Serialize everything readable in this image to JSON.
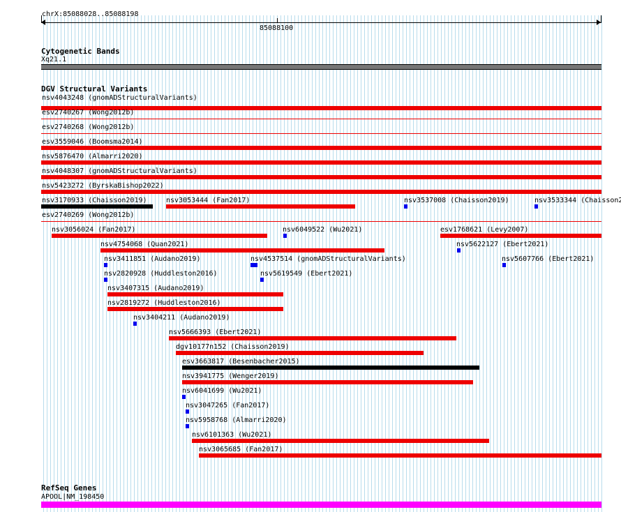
{
  "ruler": {
    "position_label": "chrX:85088028..85088198",
    "tick_label": "85088100"
  },
  "cytoband": {
    "title": "Cytogenetic Bands",
    "band": "Xq21.1",
    "band_color": "#777777"
  },
  "dgv": {
    "title": "DGV Structural Variants",
    "colors": {
      "loss": "#ee0000",
      "gain": "#0000ee",
      "other": "#000000"
    },
    "features": [
      {
        "label": "nsv4043248 (gnomADStructuralVariants)",
        "color": "loss"
      },
      {
        "label": "esv2740267 (Wong2012b)",
        "color": "loss"
      },
      {
        "label": "esv2740268 (Wong2012b)",
        "color": "loss"
      },
      {
        "label": "esv3559046 (Boomsma2014)",
        "color": "loss"
      },
      {
        "label": "nsv5876470 (Almarri2020)",
        "color": "loss"
      },
      {
        "label": "nsv4048307 (gnomADStructuralVariants)",
        "color": "loss"
      },
      {
        "label": "nsv5423272 (ByrskaBishop2022)",
        "color": "loss"
      },
      {
        "label": "nsv3170933 (Chaisson2019)",
        "color": "other"
      },
      {
        "label": "nsv3053444 (Fan2017)",
        "color": "loss"
      },
      {
        "label": "nsv3537008 (Chaisson2019)",
        "color": "gain"
      },
      {
        "label": "nsv3533344 (Chaisson2",
        "color": "gain"
      },
      {
        "label": "esv2740269 (Wong2012b)",
        "color": "loss"
      },
      {
        "label": "nsv3056024 (Fan2017)",
        "color": "loss"
      },
      {
        "label": "nsv6049522 (Wu2021)",
        "color": "gain"
      },
      {
        "label": "esv1768621 (Levy2007)",
        "color": "loss"
      },
      {
        "label": "nsv4754068 (Quan2021)",
        "color": "loss"
      },
      {
        "label": "nsv5622127 (Ebert2021)",
        "color": "gain"
      },
      {
        "label": "nsv3411851 (Audano2019)",
        "color": "gain"
      },
      {
        "label": "nsv4537514 (gnomADStructuralVariants)",
        "color": "gain"
      },
      {
        "label": "nsv5607766 (Ebert2021)",
        "color": "gain"
      },
      {
        "label": "nsv2820928 (Huddleston2016)",
        "color": "gain"
      },
      {
        "label": "nsv5619549 (Ebert2021)",
        "color": "gain"
      },
      {
        "label": "nsv3407315 (Audano2019)",
        "color": "loss"
      },
      {
        "label": "nsv2819272 (Huddleston2016)",
        "color": "loss"
      },
      {
        "label": "nsv3404211 (Audano2019)",
        "color": "gain"
      },
      {
        "label": "nsv5666393 (Ebert2021)",
        "color": "loss"
      },
      {
        "label": "dgv10177n152 (Chaisson2019)",
        "color": "loss"
      },
      {
        "label": "esv3663817 (Besenbacher2015)",
        "color": "other"
      },
      {
        "label": "nsv3941775 (Wenger2019)",
        "color": "loss"
      },
      {
        "label": "nsv6041699 (Wu2021)",
        "color": "gain"
      },
      {
        "label": "nsv3047265 (Fan2017)",
        "color": "gain"
      },
      {
        "label": "nsv5958768 (Almarri2020)",
        "color": "gain"
      },
      {
        "label": "nsv6101363 (Wu2021)",
        "color": "loss"
      },
      {
        "label": "nsv3065685 (Fan2017)",
        "color": "loss"
      }
    ]
  },
  "refseq": {
    "title": "RefSeq Genes",
    "gene": "APOOL|NM_198450",
    "gene_color": "#ff00ff"
  }
}
